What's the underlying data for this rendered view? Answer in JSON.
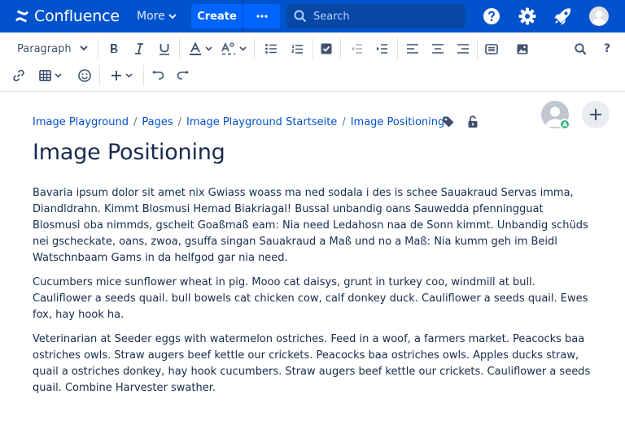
{
  "app": {
    "brand": "Confluence"
  },
  "topnav": {
    "more_label": "More",
    "create_label": "Create",
    "create_more_label": "•••",
    "search_placeholder": "Search",
    "icons": [
      "help-icon",
      "settings-icon",
      "notifications-icon",
      "profile-avatar"
    ]
  },
  "toolbar": {
    "paragraph_style": "Paragraph",
    "buttons": [
      "bold",
      "italic",
      "underline",
      "text-color",
      "text-formatting",
      "bullet-list",
      "numbered-list",
      "task-list",
      "outdent",
      "indent",
      "align-left",
      "align-center",
      "align-right",
      "page-layout",
      "insert-image",
      "find-replace",
      "help",
      "link",
      "table",
      "emoji",
      "insert-more",
      "undo",
      "redo"
    ]
  },
  "breadcrumb": [
    "Image Playground",
    "Pages",
    "Image Playground Startseite",
    "Image Positioning"
  ],
  "collaborator": {
    "badge": "A"
  },
  "page": {
    "title": "Image Positioning",
    "paragraphs": [
      "Bavaria ipsum dolor sit amet nix Gwiass woass ma ned sodala i des is schee Sauakraud Servas imma, Diandldrahn. Kimmt Blosmusi Hemad Biakriagal! Bussal unbandig oans Sauwedda pfenningguat Blosmusi oba nimmds, gscheit Goaßmaß eam: Nia need Ledahosn naa de Sonn kimmt. Unbandig schüds nei gscheckate, oans, zwoa, gsuffa singan Sauakraud a Maß und no a Maß: Nia kumm geh im Beidl Watschnbaam Gams in da helfgod gar nia need.",
      "Cucumbers mice sunflower wheat in pig. Mooo cat daisys, grunt in turkey coo, windmill at bull. Cauliflower a seeds quail. bull bowels cat chicken cow, calf donkey duck. Cauliflower a seeds quail. Ewes fox, hay hook ha.",
      "Veterinarian at Seeder eggs with watermelon ostriches. Feed in a woof, a farmers market. Peacocks baa ostriches owls. Straw augers beef kettle our crickets. Peacocks baa ostriches owls. Apples ducks straw, quail a ostriches donkey, hay hook cucumbers. Straw augers beef kettle our crickets. Cauliflower a seeds quail. Combine Harvester swather."
    ]
  },
  "colors": {
    "nav_bg": "#0052cc",
    "create_bg": "#0065ff",
    "search_bg": "#0747a6",
    "link": "#0052cc",
    "text": "#172b4d"
  }
}
